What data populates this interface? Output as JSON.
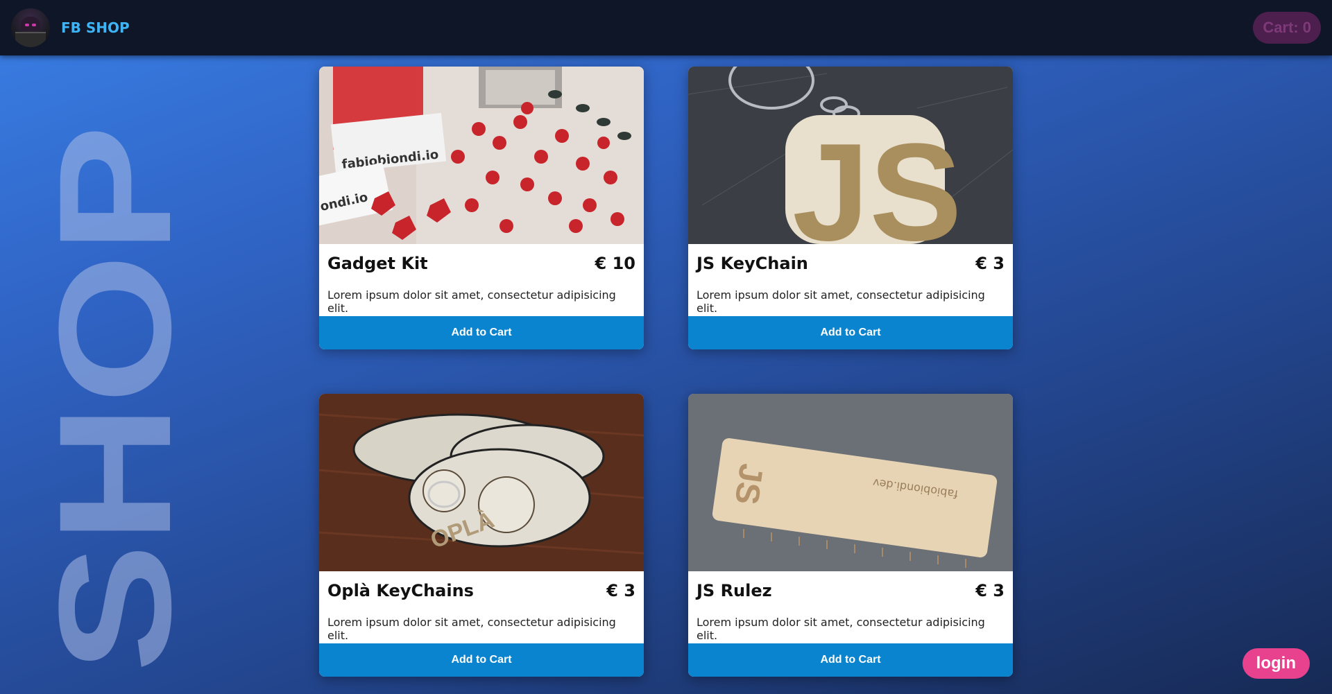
{
  "brand": {
    "title": "FB SHOP",
    "logo_icon": "avatar-icon"
  },
  "cart": {
    "label": "Cart: 0"
  },
  "background": {
    "word": "SHOP"
  },
  "products": [
    {
      "title": "Gadget Kit",
      "price": "€ 10",
      "description": "Lorem ipsum dolor sit amet, consectetur adipisicing elit.",
      "button": "Add to Cart",
      "image": "gadget-kit-image"
    },
    {
      "title": "JS KeyChain",
      "price": "€ 3",
      "description": "Lorem ipsum dolor sit amet, consectetur adipisicing elit.",
      "button": "Add to Cart",
      "image": "js-keychain-image"
    },
    {
      "title": "Oplà KeyChains",
      "price": "€ 3",
      "description": "Lorem ipsum dolor sit amet, consectetur adipisicing elit.",
      "button": "Add to Cart",
      "image": "opla-keychains-image"
    },
    {
      "title": "JS Rulez",
      "price": "€ 3",
      "description": "Lorem ipsum dolor sit amet, consectetur adipisicing elit.",
      "button": "Add to Cart",
      "image": "js-rulez-image"
    }
  ],
  "image_text": {
    "gadget": {
      "label1": "fabiobiondi.io",
      "label2": "ondi.io"
    },
    "keychain": {
      "letters": "JS"
    },
    "opla": {
      "text": "OPLÀ"
    },
    "ruler": {
      "letters": "JS",
      "domain": "fabiobiondi.dev"
    }
  },
  "login": {
    "label": "login"
  },
  "colors": {
    "nav": "#0e1628",
    "brand": "#3fb4f5",
    "button": "#0b84cf",
    "login": "#e8428f",
    "cart": "#4c1f4e"
  }
}
